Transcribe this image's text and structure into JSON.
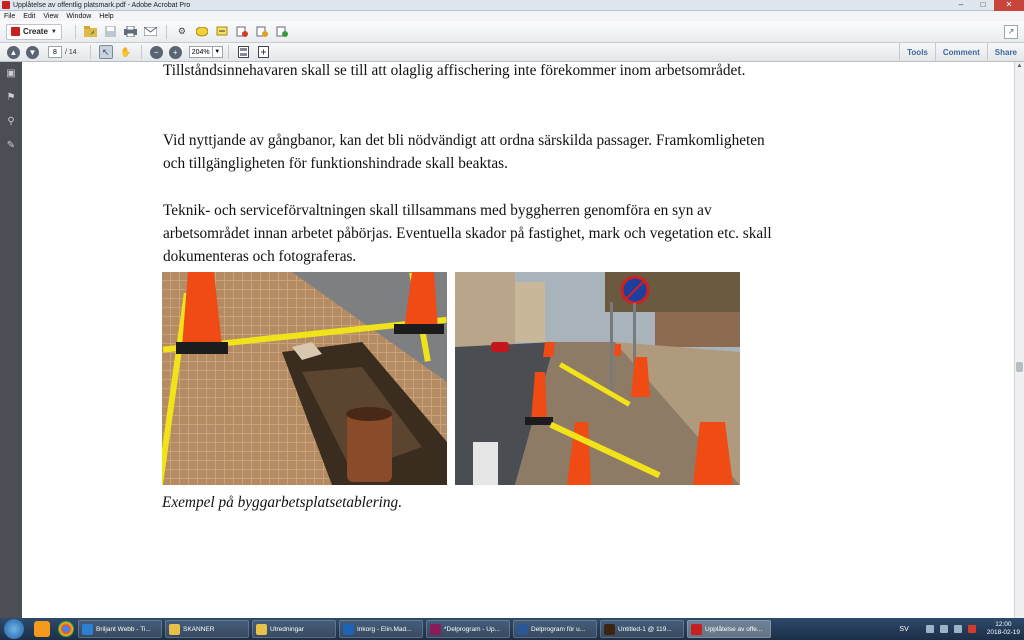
{
  "window": {
    "title": "Upplåtelse av offentlig platsmark.pdf - Adobe Acrobat Pro"
  },
  "menu": {
    "items": [
      "File",
      "Edit",
      "View",
      "Window",
      "Help"
    ]
  },
  "toolbar": {
    "create_label": "Create"
  },
  "nav": {
    "page_current": "8",
    "page_total": "/ 14",
    "zoom": "204%"
  },
  "panel_links": {
    "tools": "Tools",
    "comment": "Comment",
    "share": "Share"
  },
  "document": {
    "p1": "Tillståndsinnehavaren skall se till att olaglig affischering inte förekommer inom arbetsområdet.",
    "p2": "Vid nyttjande av gångbanor, kan det bli nödvändigt att ordna särskilda passager. Framkomligheten och tillgängligheten för funktionshindrade skall beaktas.",
    "p3": "Teknik- och serviceförvaltningen skall tillsammans med byggherren genomföra en syn av arbetsområdet innan arbetet påbörjas. Eventuella skador på fastighet, mark och vegetation etc. skall dokumenteras och fotograferas.",
    "caption": "Exempel på byggarbetsplatsetablering."
  },
  "taskbar": {
    "tasks": [
      {
        "label": "Briljant Webb - Ti...",
        "color": "#2d7fd4"
      },
      {
        "label": "SKANNER",
        "color": "#e8c248"
      },
      {
        "label": "Utredningar",
        "color": "#e8c248"
      },
      {
        "label": "Inkorg - Elin.Mad...",
        "color": "#1f63b5"
      },
      {
        "label": "*Delprogram - Up...",
        "color": "#8a1c5a"
      },
      {
        "label": "Delprogram för u...",
        "color": "#2b5797"
      },
      {
        "label": "Untitled-1 @ 119...",
        "color": "#3b2410"
      },
      {
        "label": "Upplåtelse av offe...",
        "color": "#c62020"
      }
    ],
    "language": "SV",
    "time": "12:00",
    "date": "2018-02-19"
  }
}
